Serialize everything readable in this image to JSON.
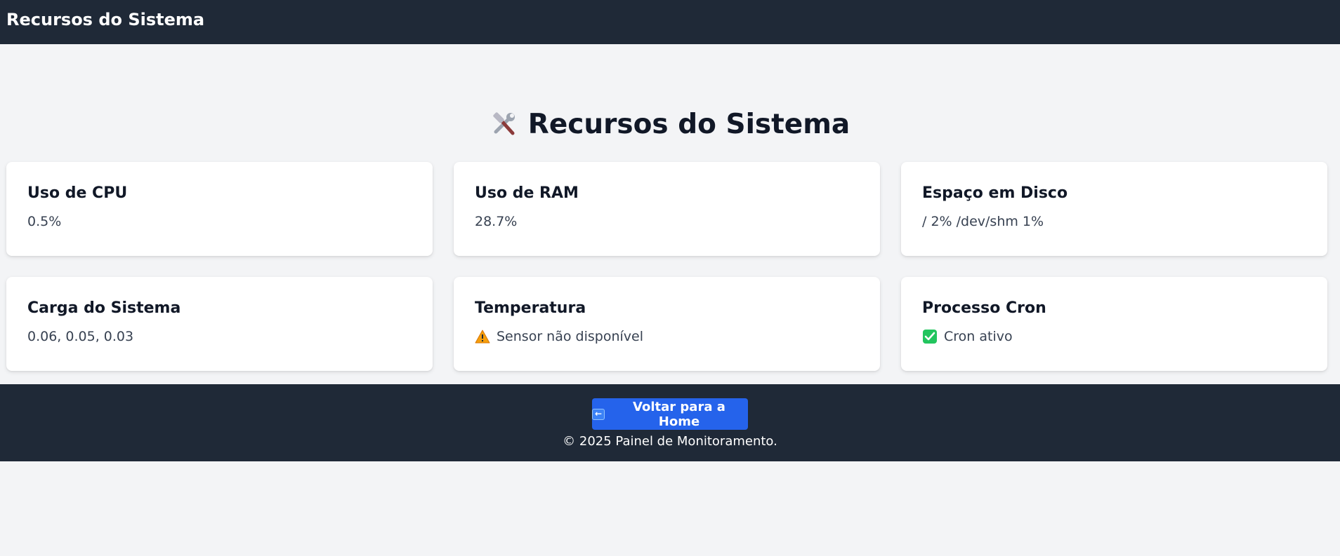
{
  "header": {
    "title": "Recursos do Sistema"
  },
  "page": {
    "title": "Recursos do Sistema",
    "title_icon": "hammer-and-wrench-icon"
  },
  "cards": [
    {
      "title": "Uso de CPU",
      "value": "0.5%"
    },
    {
      "title": "Uso de RAM",
      "value": "28.7%"
    },
    {
      "title": "Espaço em Disco",
      "value": "/ 2% /dev/shm 1%"
    },
    {
      "title": "Carga do Sistema",
      "value": "0.06, 0.05, 0.03"
    },
    {
      "title": "Temperatura",
      "value": "Sensor não disponível",
      "icon": "warning-icon"
    },
    {
      "title": "Processo Cron",
      "value": "Cron ativo",
      "icon": "check-mark-icon"
    }
  ],
  "footer": {
    "home_button_label": "Voltar para a Home",
    "home_button_icon": "left-arrow-icon",
    "copyright": "© 2025 Painel de Monitoramento."
  },
  "colors": {
    "header_bg": "#1f2937",
    "page_bg": "#f3f4f6",
    "button_bg": "#2563eb",
    "card_bg": "#ffffff"
  }
}
